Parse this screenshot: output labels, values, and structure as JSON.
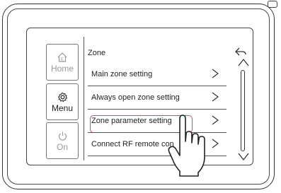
{
  "sidebar": {
    "home": {
      "label": "Home",
      "icon": "home-icon"
    },
    "menu": {
      "label": "Menu",
      "icon": "gear-icon"
    },
    "on": {
      "label": "On",
      "icon": "power-icon"
    }
  },
  "header": {
    "title": "Zone",
    "back_icon": "back-arrow-icon"
  },
  "menu_items": [
    {
      "label": "Main zone setting"
    },
    {
      "label": "Always open zone setting"
    },
    {
      "label": "Zone parameter setting",
      "highlighted": true
    },
    {
      "label": "Connect RF remote con"
    }
  ],
  "colors": {
    "highlight": "#e0407a",
    "outline": "#333333",
    "disabled_text": "#999999"
  }
}
